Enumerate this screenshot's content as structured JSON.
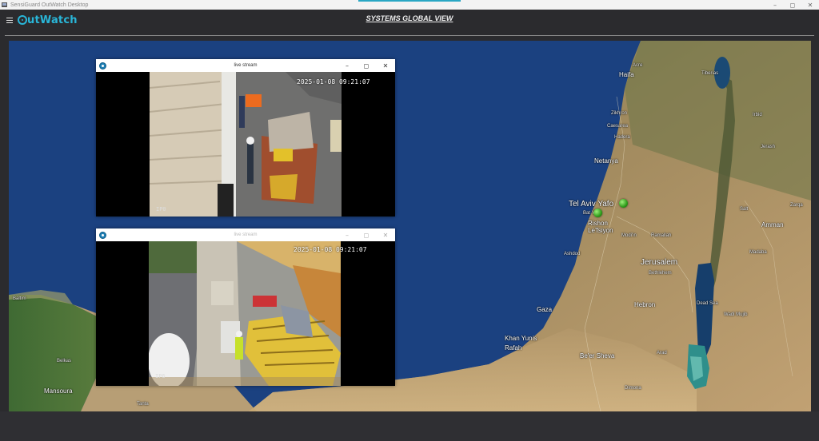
{
  "window": {
    "title": "SensiGuard OutWatch Desktop",
    "controls": {
      "minimize": "–",
      "maximize": "◻",
      "close": "✕"
    }
  },
  "app": {
    "logo_text": "utWatch",
    "page_title": "SYSTEMS GLOBAL VIEW",
    "menu_icon": "hamburger-icon"
  },
  "map": {
    "labels": {
      "haifa": "Haifa",
      "acre": "Acre",
      "tiberias": "Tiberias",
      "irbid": "Irbid",
      "zikhron": "Zikhron",
      "caesarea": "Caesarea",
      "hadera": "Hadera",
      "netanya": "Netanya",
      "tel_aviv": "Tel Aviv Yafo",
      "bat_yam": "Bat Yam",
      "rishon": "Rishon",
      "letsiyon": "LeTsiyon",
      "modiin": "Modi'in",
      "ramallah": "Ramallah",
      "ashdod": "Ashdod",
      "jerusalem": "Jerusalem",
      "bethlehem": "Bethlehem",
      "hebron": "Hebron",
      "gaza": "Gaza",
      "khan_yunis": "Khan Yunis",
      "rafah": "Rafah",
      "beer_sheva": "Be'er Sheva",
      "amman": "Amman",
      "zarqa": "Zarqa",
      "jerash": "Jerash",
      "salt": "Salt",
      "madaba": "Madaba",
      "wadi_mujib": "Wadi Mujib",
      "arad": "Arad",
      "dimona": "Dimona",
      "mansoura": "Mansoura",
      "baltim": "Baltim",
      "tanta": "Tanta",
      "belkas": "Belkas",
      "dead_sea": "Dead Sea"
    }
  },
  "streams": [
    {
      "title": "live stream",
      "timestamp": "2025-01-08 09:21:07",
      "camera": "IP0"
    },
    {
      "title": "live stream",
      "timestamp": "2025-01-08 09:21:07",
      "camera": "IP6"
    }
  ],
  "colors": {
    "sea": "#193f7c",
    "accent": "#29b6d8",
    "marker": "#2e9b1b",
    "header_bg": "#2b2b2e"
  }
}
